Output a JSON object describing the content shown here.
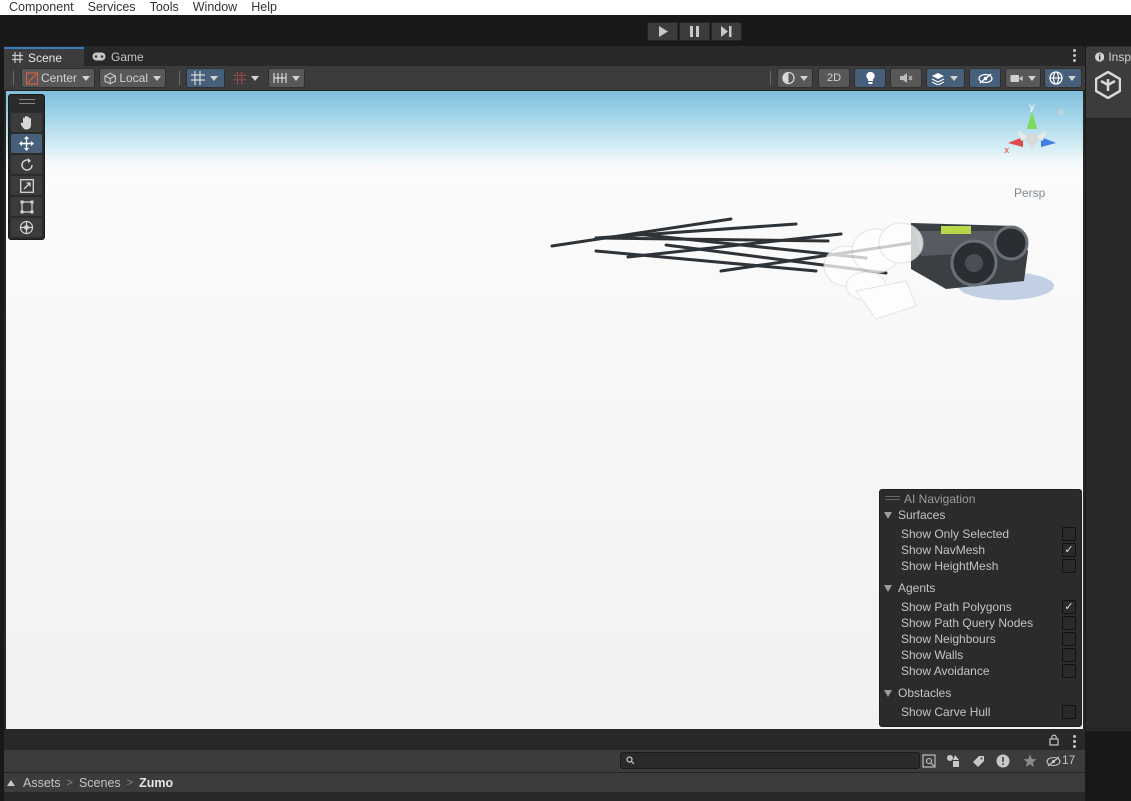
{
  "menu": [
    "Component",
    "Services",
    "Tools",
    "Window",
    "Help"
  ],
  "scene_window": {
    "tabs": [
      {
        "label": "Scene"
      },
      {
        "label": "Game"
      }
    ],
    "toolbar": {
      "pivot_mode": "Center",
      "pivot_rotation": "Local",
      "mode_2d": "2D"
    },
    "viewport": {
      "projection_label": "Persp",
      "gizmo_axis": "y"
    },
    "ai_navigation": {
      "title": "AI Navigation",
      "sections": [
        {
          "label": "Surfaces",
          "options": [
            {
              "label": "Show Only Selected",
              "checked": false
            },
            {
              "label": "Show NavMesh",
              "checked": true
            },
            {
              "label": "Show HeightMesh",
              "checked": false
            }
          ]
        },
        {
          "label": "Agents",
          "options": [
            {
              "label": "Show Path Polygons",
              "checked": true
            },
            {
              "label": "Show Path Query Nodes",
              "checked": false
            },
            {
              "label": "Show Neighbours",
              "checked": false
            },
            {
              "label": "Show Walls",
              "checked": false
            },
            {
              "label": "Show Avoidance",
              "checked": false
            }
          ]
        },
        {
          "label": "Obstacles",
          "options": [
            {
              "label": "Show Carve Hull",
              "checked": false
            }
          ]
        }
      ]
    }
  },
  "inspector": {
    "tab_label": "Insp"
  },
  "project": {
    "search_placeholder": "",
    "hidden_count": "17",
    "breadcrumb": [
      "Assets",
      "Scenes",
      "Zumo"
    ]
  },
  "colors": {
    "accent": "#3a79bb",
    "active_button": "#46607c",
    "panel": "#3c3c3c",
    "dark_panel": "#282828"
  }
}
